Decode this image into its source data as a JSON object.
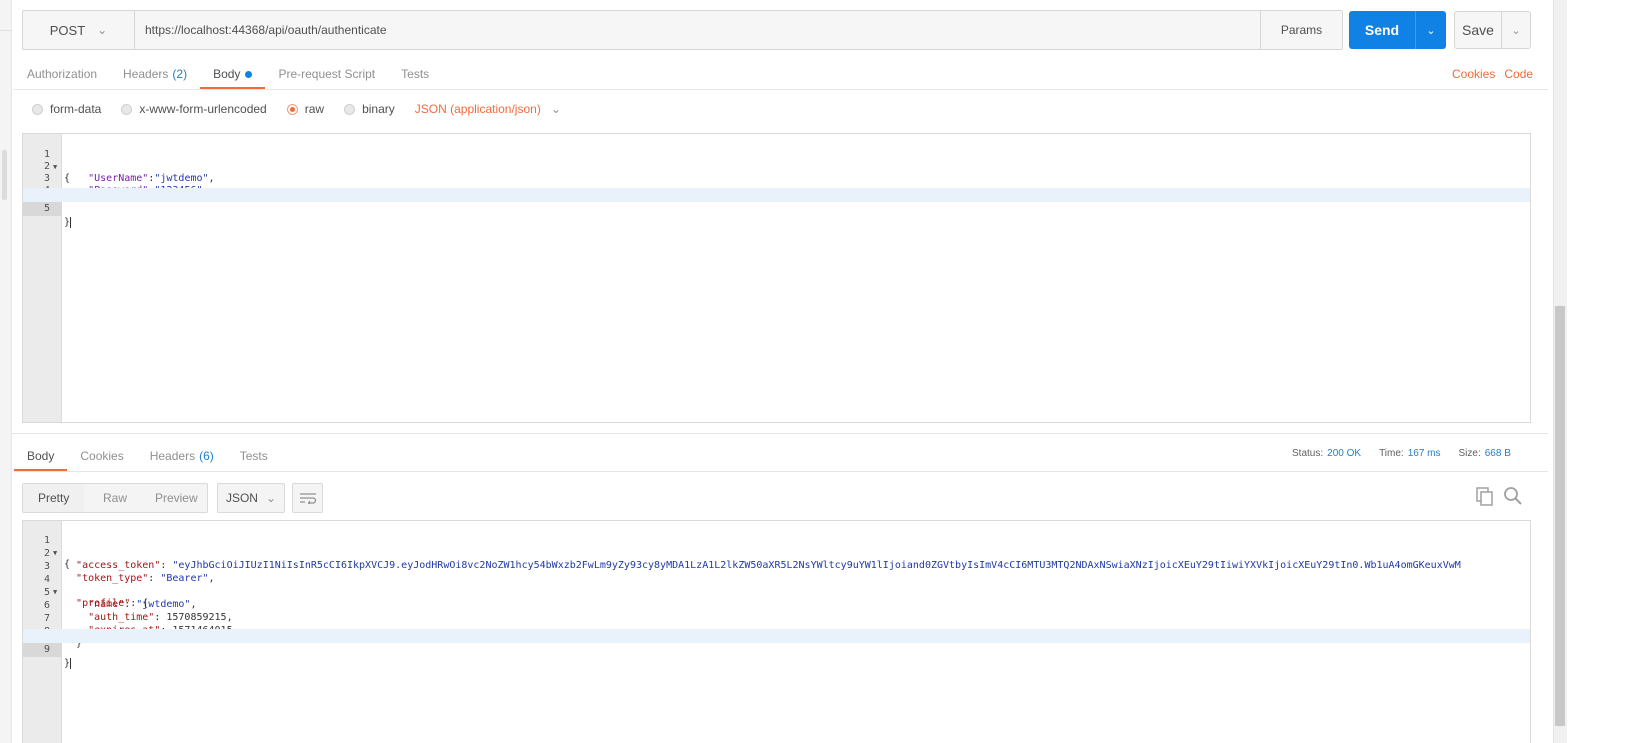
{
  "request": {
    "method": "POST",
    "url": "https://localhost:44368/api/oauth/authenticate",
    "params_label": "Params",
    "send_label": "Send",
    "save_label": "Save"
  },
  "request_tabs": [
    {
      "label": "Authorization",
      "count": ""
    },
    {
      "label": "Headers",
      "count": "(2)"
    },
    {
      "label": "Body",
      "count": ""
    },
    {
      "label": "Pre-request Script",
      "count": ""
    },
    {
      "label": "Tests",
      "count": ""
    }
  ],
  "right_links": {
    "cookies": "Cookies",
    "code": "Code"
  },
  "body_types": [
    "form-data",
    "x-www-form-urlencoded",
    "raw",
    "binary"
  ],
  "selected_body_type": "raw",
  "content_type": "JSON (application/json)",
  "request_body": {
    "line_numbers": [
      "1",
      "2",
      "3",
      "4",
      "5"
    ],
    "l1": "{",
    "l2_key": "\"UserName\"",
    "l2_val": "\"jwtdemo\"",
    "l3_key": "\"Password\"",
    "l3_val": "\"123456\"",
    "l5": "}"
  },
  "response_tabs": [
    {
      "label": "Body",
      "count": ""
    },
    {
      "label": "Cookies",
      "count": ""
    },
    {
      "label": "Headers",
      "count": "(6)"
    },
    {
      "label": "Tests",
      "count": ""
    }
  ],
  "status": {
    "status_label": "Status:",
    "status_value": "200 OK",
    "time_label": "Time:",
    "time_value": "167 ms",
    "size_label": "Size:",
    "size_value": "668 B"
  },
  "view_modes": [
    "Pretty",
    "Raw",
    "Preview"
  ],
  "format": "JSON",
  "response_body": {
    "line_numbers": [
      "1",
      "2",
      "3",
      "4",
      "5",
      "6",
      "7",
      "8",
      "9"
    ],
    "l1": "{",
    "access_key": "\"access_token\"",
    "access_val": "\"eyJhbGciOiJIUzI1NiIsInR5cCI6IkpXVCJ9.eyJodHRwOi8vc2NoZW1hcy54bWxzb2FwLm9yZy93cy8yMDA1LzA1L2lkZW50aXR5L2NsYWltcy9uYW1lIjoiand0ZGVtbyIsImV4cCI6MTU3MTQ2NDAxNSwiaXNzIjoicXEuY29tIiwiYXVkIjoicXEuY29tIn0.Wb1uA4omGKeuxVwM",
    "type_key": "\"token_type\"",
    "type_val": "\"Bearer\"",
    "profile_key": "\"profile\"",
    "name_key": "\"name\"",
    "name_val": "\"jwtdemo\"",
    "auth_key": "\"auth_time\"",
    "auth_val": "1570859215",
    "exp_key": "\"expires_at\"",
    "exp_val": "1571464015",
    "l8": "}",
    "l9": "}"
  }
}
